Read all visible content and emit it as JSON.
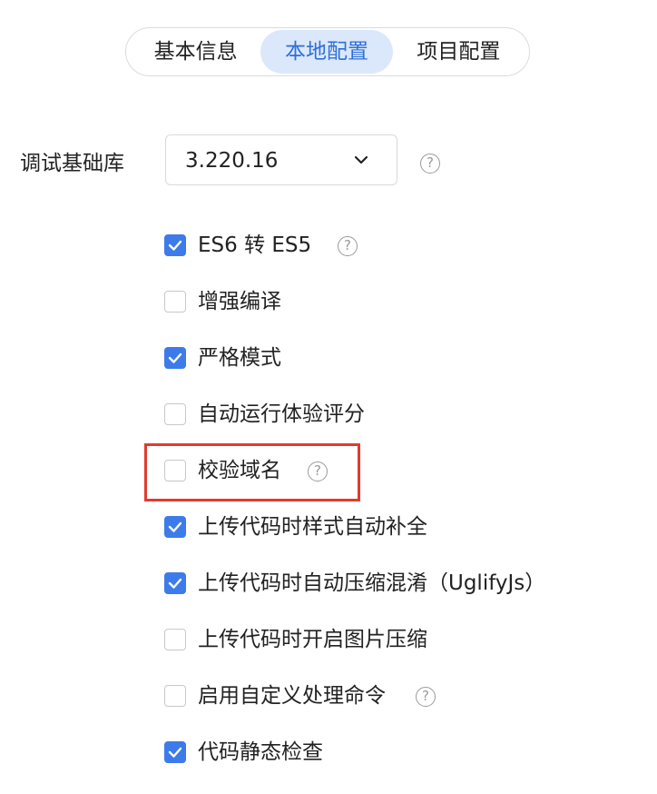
{
  "tabs": [
    {
      "label": "基本信息",
      "active": false
    },
    {
      "label": "本地配置",
      "active": true
    },
    {
      "label": "项目配置",
      "active": false
    }
  ],
  "library": {
    "label": "调试基础库",
    "value": "3.220.16",
    "help_icon": "question-circle-icon"
  },
  "options": [
    {
      "label": "ES6 转 ES5",
      "checked": true,
      "help": true
    },
    {
      "label": "增强编译",
      "checked": false,
      "help": false
    },
    {
      "label": "严格模式",
      "checked": true,
      "help": false
    },
    {
      "label": "自动运行体验评分",
      "checked": false,
      "help": false
    },
    {
      "label": "校验域名",
      "checked": false,
      "help": true,
      "highlighted": true
    },
    {
      "label": "上传代码时样式自动补全",
      "checked": true,
      "help": false
    },
    {
      "label": "上传代码时自动压缩混淆（UglifyJs）",
      "checked": true,
      "help": false
    },
    {
      "label": "上传代码时开启图片压缩",
      "checked": false,
      "help": false
    },
    {
      "label": "启用自定义处理命令",
      "checked": false,
      "help": true
    },
    {
      "label": "代码静态检查",
      "checked": true,
      "help": false
    }
  ],
  "colors": {
    "accent": "#3d7bea",
    "tab_active_bg": "#dbe8fb",
    "tab_active_text": "#2f6fd8",
    "highlight": "#e23b2e"
  }
}
